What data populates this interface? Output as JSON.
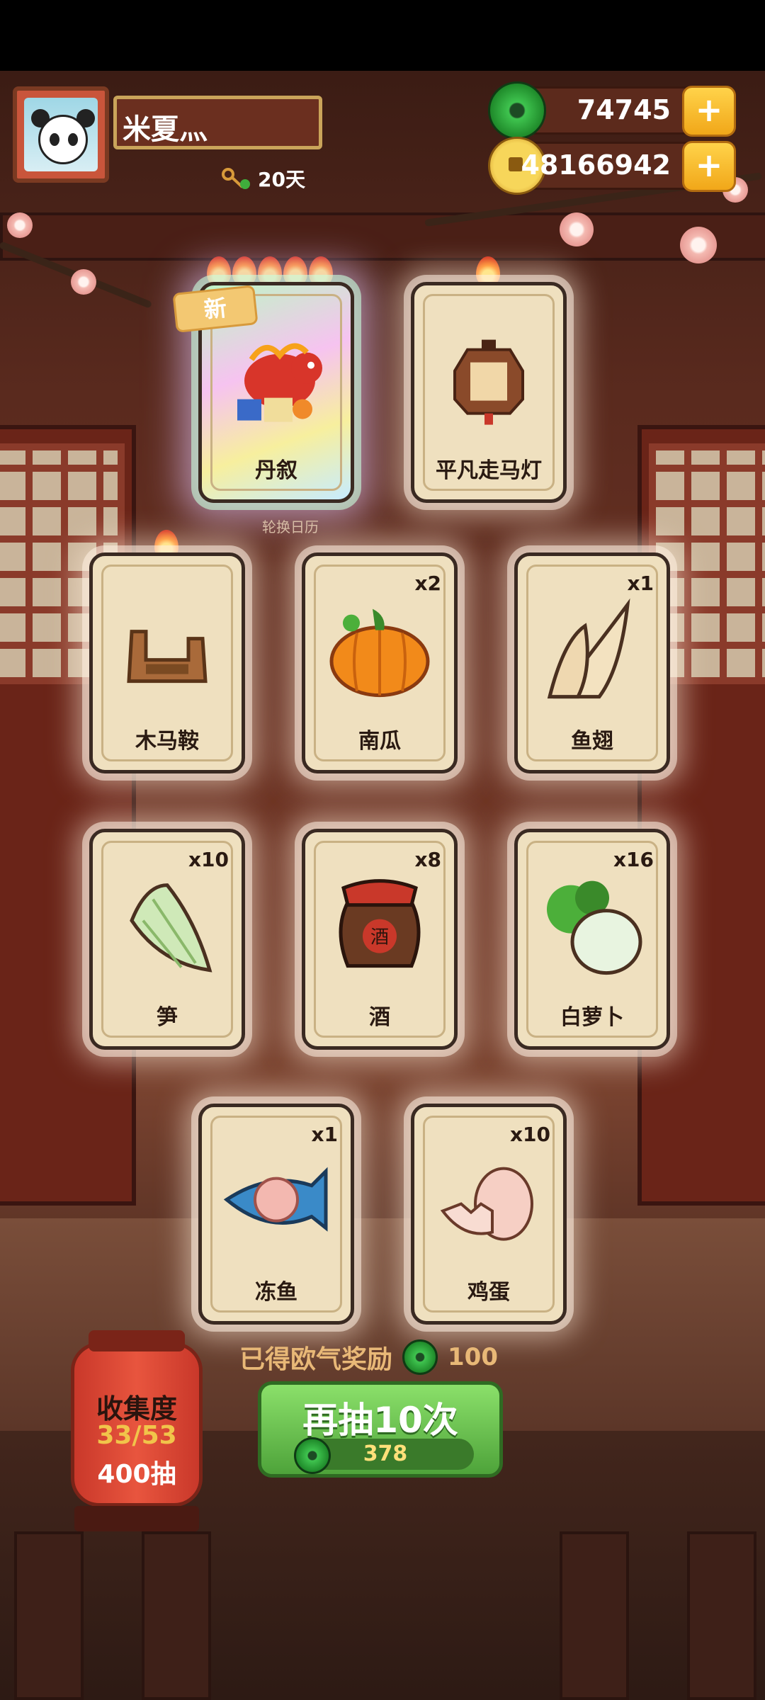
{
  "player": {
    "name": "米夏灬",
    "days": "20天"
  },
  "currency": {
    "jade": "74745",
    "coins": "48166942"
  },
  "cards": [
    {
      "name": "丹叙",
      "qty": "",
      "flames": 5,
      "new": true
    },
    {
      "name": "平凡走马灯",
      "qty": "",
      "flames": 1,
      "new": false
    },
    {
      "name": "木马鞍",
      "qty": "",
      "flames": 1,
      "new": false
    },
    {
      "name": "南瓜",
      "qty": "x2",
      "flames": 0,
      "new": false
    },
    {
      "name": "鱼翅",
      "qty": "x1",
      "flames": 0,
      "new": false
    },
    {
      "name": "笋",
      "qty": "x10",
      "flames": 0,
      "new": false
    },
    {
      "name": "酒",
      "qty": "x8",
      "flames": 0,
      "new": false
    },
    {
      "name": "白萝卜",
      "qty": "x16",
      "flames": 0,
      "new": false
    },
    {
      "name": "冻鱼",
      "qty": "x1",
      "flames": 0,
      "new": false
    },
    {
      "name": "鸡蛋",
      "qty": "x10",
      "flames": 0,
      "new": false
    }
  ],
  "new_tag": "新",
  "card_sublabel": "轮换日历",
  "jar_label": "酒",
  "reward": {
    "label": "已得欧气奖励",
    "value": "100"
  },
  "draw_button": {
    "label": "再抽10次",
    "cost": "378"
  },
  "collection": {
    "title": "收集度",
    "progress": "33/53",
    "draws": "400抽"
  },
  "colors": {
    "jade": "#2fae3c",
    "gold": "#f1a719",
    "accent_red": "#c9382a"
  }
}
